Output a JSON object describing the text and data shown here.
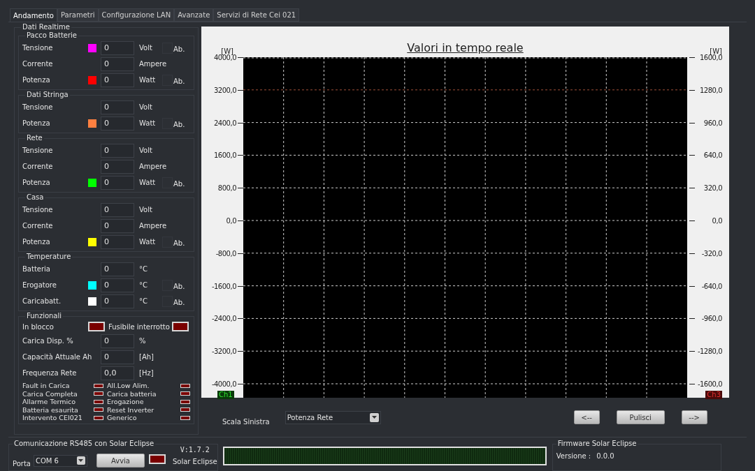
{
  "tabs": [
    {
      "label": "Andamento",
      "selected": true
    },
    {
      "label": "Parametri",
      "selected": false
    },
    {
      "label": "Configurazione LAN",
      "selected": false
    },
    {
      "label": "Avanzate",
      "selected": false
    },
    {
      "label": "Servizi di Rete Cei 021",
      "selected": false
    }
  ],
  "realtime": {
    "title": "Dati Realtime",
    "groups": [
      {
        "title": "Pacco Batterie",
        "rows": [
          {
            "label": "Tensione",
            "color": "#ff00ff",
            "value": "0",
            "unit": "Volt",
            "ab": {
              "label": "Ab.",
              "checked": false
            }
          },
          {
            "label": "Corrente",
            "value": "0",
            "unit": "Ampere"
          },
          {
            "label": "Potenza",
            "color": "#ff0000",
            "value": "0",
            "unit": "Watt",
            "ab": {
              "label": "Ab.",
              "checked": false
            }
          }
        ]
      },
      {
        "title": "Dati Stringa",
        "rows": [
          {
            "label": "Tensione",
            "value": "0",
            "unit": "Volt"
          },
          {
            "label": "Potenza",
            "color": "#ff8040",
            "value": "0",
            "unit": "Watt",
            "ab": {
              "label": "Ab.",
              "checked": false
            }
          }
        ]
      },
      {
        "title": "Rete",
        "rows": [
          {
            "label": "Tensione",
            "value": "0",
            "unit": "Volt"
          },
          {
            "label": "Corrente",
            "value": "0",
            "unit": "Ampere"
          },
          {
            "label": "Potenza",
            "color": "#00ff00",
            "value": "0",
            "unit": "Watt",
            "ab": {
              "label": "Ab.",
              "checked": false
            }
          }
        ]
      },
      {
        "title": "Casa",
        "rows": [
          {
            "label": "Tensione",
            "value": "0",
            "unit": "Volt"
          },
          {
            "label": "Corrente",
            "value": "0",
            "unit": "Ampere"
          },
          {
            "label": "Potenza",
            "color": "#ffff00",
            "value": "0",
            "unit": "Watt",
            "ab": {
              "label": "Ab.",
              "checked": false
            }
          }
        ]
      },
      {
        "title": "Temperature",
        "rows": [
          {
            "label": "Batteria",
            "value": "0",
            "unit": "°C"
          },
          {
            "label": "Erogatore",
            "color": "#00ffff",
            "value": "0",
            "unit": "°C",
            "ab": {
              "label": "Ab.",
              "checked": false
            }
          },
          {
            "label": "Caricabatt.",
            "color": "#ffffff",
            "value": "0",
            "unit": "°C",
            "ab": {
              "label": "Ab.",
              "checked": false
            }
          }
        ]
      }
    ]
  },
  "funzionali": {
    "title": "Funzionali",
    "indicators": [
      {
        "label": "In blocco",
        "active": false
      },
      {
        "label": "Fusibile interrotto",
        "active": false
      }
    ],
    "fields": [
      {
        "label": "Carica Disp. %",
        "value": "0",
        "unit": "%"
      },
      {
        "label": "Capacità Attuale Ah",
        "value": "0",
        "unit": "[Ah]"
      },
      {
        "label": "Frequenza Rete",
        "value": "0,0",
        "unit": "[Hz]"
      }
    ],
    "alarms": [
      {
        "label": "Fault in Carica",
        "active": false
      },
      {
        "label": "All.Low Alim.",
        "active": false
      },
      {
        "label": "Carica Completa",
        "active": false
      },
      {
        "label": "Carica batteria",
        "active": false
      },
      {
        "label": "Allarme Termico",
        "active": false
      },
      {
        "label": "Erogazione",
        "active": false
      },
      {
        "label": "Batteria esaurita",
        "active": false
      },
      {
        "label": "Reset Inverter",
        "active": false
      },
      {
        "label": "Intervento CEI021",
        "active": false
      },
      {
        "label": "Generico",
        "active": false
      }
    ]
  },
  "chart": {
    "title": "Valori in tempo reale",
    "left_unit": "[W]",
    "right_unit": "[W]",
    "left_ticks": [
      {
        "label": "4000,0",
        "highlight": false
      },
      {
        "label": "3200,0",
        "highlight": true
      },
      {
        "label": "2400,0",
        "highlight": false
      },
      {
        "label": "1600,0",
        "highlight": false
      },
      {
        "label": "800,0",
        "highlight": false
      },
      {
        "label": "0,0",
        "highlight": false
      },
      {
        "label": "-800,0",
        "highlight": false
      },
      {
        "label": "-1600,0",
        "highlight": false
      },
      {
        "label": "-2400,0",
        "highlight": false
      },
      {
        "label": "-3200,0",
        "highlight": false
      },
      {
        "label": "-4000,0",
        "highlight": false
      }
    ],
    "right_ticks": [
      "1600,0",
      "1280,0",
      "960,0",
      "640,0",
      "320,0",
      "0,0",
      "-320,0",
      "-640,0",
      "-960,0",
      "-1280,0",
      "-1600,0"
    ],
    "left_channel": "Ch1",
    "right_channel": "Ch3"
  },
  "scale": {
    "label": "Scala Sinistra",
    "value": "Potenza Rete"
  },
  "nav_buttons": [
    "<--",
    "Pulisci",
    "-->"
  ],
  "comm": {
    "title": "Comunicazione RS485 con  Solar Eclipse",
    "port_label": "Porta",
    "port": "COM 6",
    "start": "Avvia",
    "link_active": false,
    "version": "V:1.7.2",
    "device": "Solar Eclipse"
  },
  "firmware": {
    "title": "Firmware  Solar Eclipse",
    "label": "Versione :",
    "value": "0.0.0"
  }
}
